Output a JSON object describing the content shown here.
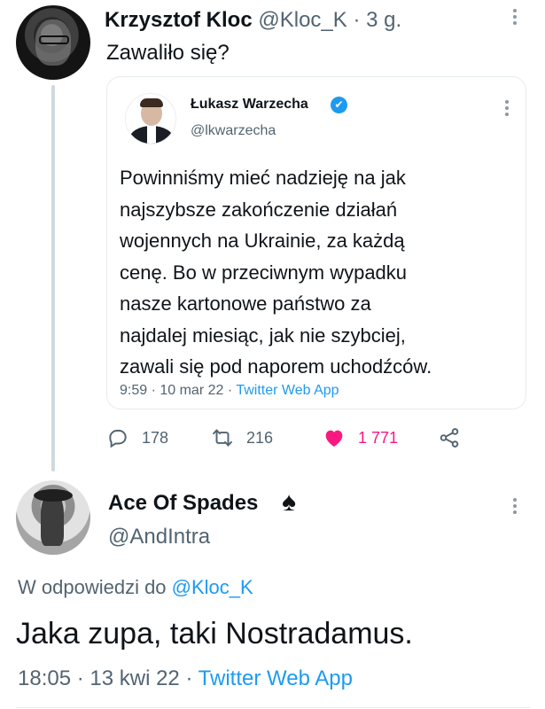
{
  "tweet": {
    "author_name": "Krzysztof Kloc",
    "author_handle": "@Kloc_K",
    "separator": "·",
    "time_ago": "3 g.",
    "text": "Zawaliło się?",
    "stats": {
      "replies": "178",
      "retweets": "216",
      "likes": "1 771"
    }
  },
  "quoted": {
    "author_name": "Łukasz Warzecha",
    "verified_icon": "✔",
    "author_handle": "@lkwarzecha",
    "text": "Powinniśmy mieć nadzieję na jak\nnajszybsze zakończenie działań\nwojennych na Ukrainie, za każdą\ncenę. Bo w przeciwnym wypadku\nnasze kartonowe państwo za\nnajdalej miesiąc, jak nie szybciej,\nzawali się pod naporem uchodźców.",
    "timestamp": "9:59 · 10 mar 22 · ",
    "source": "Twitter Web App"
  },
  "reply": {
    "author_name": "Ace Of Spades",
    "name_emoji": "♠",
    "author_handle": "@AndIntra",
    "replying_prefix": "W odpowiedzi do ",
    "replying_to": "@Kloc_K",
    "text": "Jaka zupa, taki Nostradamus.",
    "timestamp": "18:05 · 13 kwi 22 · ",
    "source": "Twitter Web App"
  },
  "colors": {
    "accent": "#1d9bf0",
    "like": "#f91880",
    "secondary_text": "#536471"
  },
  "icons": {
    "reply": "reply-icon",
    "retweet": "retweet-icon",
    "like": "heart-icon",
    "share": "share-icon",
    "more": "more-icon",
    "verified": "verified-badge-icon"
  }
}
